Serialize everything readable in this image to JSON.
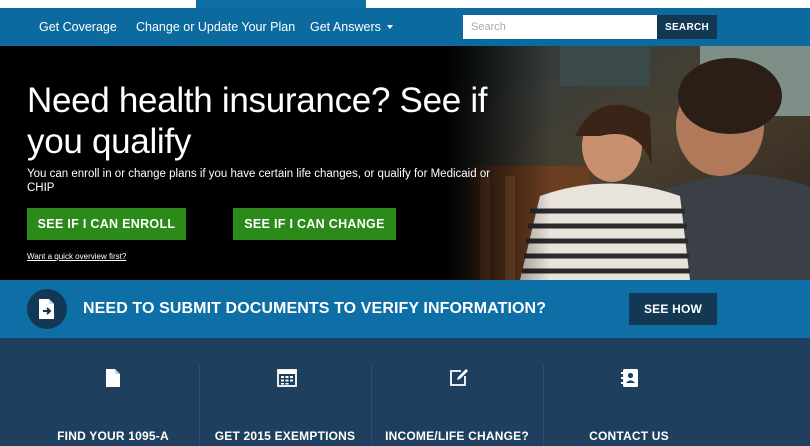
{
  "nav": {
    "items": [
      {
        "label": "Get Coverage"
      },
      {
        "label": "Change or Update Your Plan"
      },
      {
        "label": "Get Answers"
      }
    ],
    "search": {
      "placeholder": "Search",
      "button": "SEARCH"
    }
  },
  "hero": {
    "title": "Need health insurance? See if you qualify",
    "subtitle": "You can enroll in or change plans if you have certain life changes, or qualify for Medicaid or CHIP",
    "enroll_button": "SEE IF I CAN ENROLL",
    "change_button": "SEE IF I CAN CHANGE",
    "overview_link": "Want a quick overview first?"
  },
  "documents_banner": {
    "text": "NEED TO SUBMIT DOCUMENTS TO VERIFY INFORMATION?",
    "button": "SEE HOW"
  },
  "tiles": [
    {
      "label": "FIND YOUR 1095-A",
      "icon": "document-icon"
    },
    {
      "label": "GET 2015 EXEMPTIONS",
      "icon": "calendar-icon"
    },
    {
      "label": "INCOME/LIFE CHANGE?",
      "icon": "edit-icon"
    },
    {
      "label": "CONTACT US",
      "icon": "contact-book-icon"
    }
  ],
  "colors": {
    "nav_blue": "#0c6a9e",
    "dark_navy": "#123853",
    "green": "#2b8a1a",
    "tile_bg": "#1f3f5e"
  }
}
